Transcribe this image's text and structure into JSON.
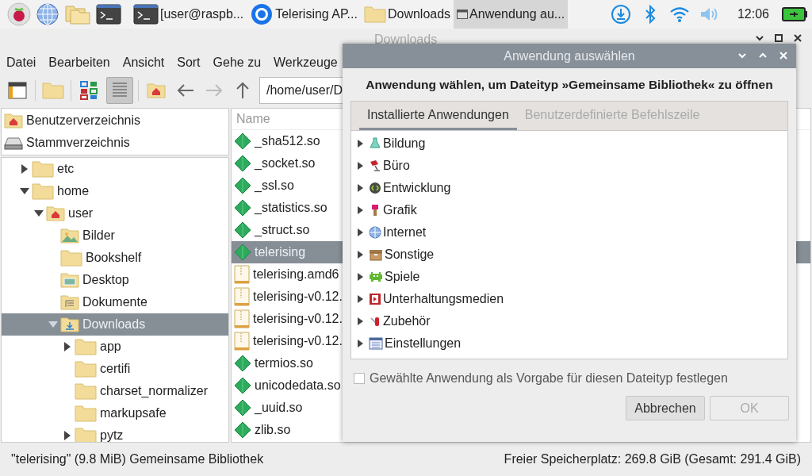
{
  "taskbar": {
    "launchers": [
      {
        "kind": "raspberry"
      },
      {
        "kind": "globe"
      },
      {
        "kind": "folders"
      },
      {
        "kind": "terminal"
      }
    ],
    "tasks": [
      {
        "kind": "terminal",
        "label": "[user@raspb...",
        "selected": false
      },
      {
        "kind": "browser",
        "label": "Telerising AP...",
        "selected": false
      },
      {
        "kind": "folder",
        "label": "Downloads",
        "selected": false
      },
      {
        "kind": "window",
        "label": "Anwendung au...",
        "selected": true
      }
    ],
    "clock": "12:06"
  },
  "file_manager": {
    "title": "Downloads",
    "menu": [
      "Datei",
      "Bearbeiten",
      "Ansicht",
      "Sort",
      "Gehe zu",
      "Werkzeuge"
    ],
    "path": "/home/user/D",
    "places": [
      {
        "kind": "home",
        "label": "Benutzerverzeichnis"
      },
      {
        "kind": "drive",
        "label": "Stammverzeichnis"
      }
    ],
    "tree": [
      {
        "label": "etc",
        "kind": "folder",
        "expanded": false,
        "selected": false
      },
      {
        "label": "home",
        "kind": "folder",
        "expanded": true,
        "selected": false,
        "children": [
          {
            "label": "user",
            "kind": "home",
            "expanded": true,
            "selected": false,
            "children": [
              {
                "label": "Bilder",
                "kind": "pictures",
                "selected": false
              },
              {
                "label": "Bookshelf",
                "kind": "folder",
                "selected": false
              },
              {
                "label": "Desktop",
                "kind": "desktop",
                "selected": false
              },
              {
                "label": "Dokumente",
                "kind": "documents",
                "selected": false
              },
              {
                "label": "Downloads",
                "kind": "downloads",
                "expanded": true,
                "selected": true,
                "children": [
                  {
                    "label": "app",
                    "kind": "folder",
                    "expanded": false,
                    "selected": false
                  },
                  {
                    "label": "certifi",
                    "kind": "folder",
                    "selected": false
                  },
                  {
                    "label": "charset_normalizer",
                    "kind": "folder",
                    "selected": false
                  },
                  {
                    "label": "markupsafe",
                    "kind": "folder",
                    "selected": false
                  },
                  {
                    "label": "pytz",
                    "kind": "folder",
                    "expanded": false,
                    "selected": false
                  }
                ]
              }
            ]
          }
        ]
      }
    ],
    "column": "Name",
    "files": [
      {
        "name": "_sha512.so",
        "kind": "library",
        "selected": false
      },
      {
        "name": "_socket.so",
        "kind": "library",
        "selected": false
      },
      {
        "name": "_ssl.so",
        "kind": "library",
        "selected": false
      },
      {
        "name": "_statistics.so",
        "kind": "library",
        "selected": false
      },
      {
        "name": "_struct.so",
        "kind": "library",
        "selected": false
      },
      {
        "name": "telerising",
        "kind": "library",
        "selected": true
      },
      {
        "name": "telerising.amd6",
        "kind": "archive",
        "selected": false
      },
      {
        "name": "telerising-v0.12.",
        "kind": "archive",
        "selected": false
      },
      {
        "name": "telerising-v0.12.",
        "kind": "archive",
        "selected": false
      },
      {
        "name": "telerising-v0.12.",
        "kind": "archive",
        "selected": false
      },
      {
        "name": "termios.so",
        "kind": "library",
        "selected": false
      },
      {
        "name": "unicodedata.so",
        "kind": "library",
        "selected": false
      },
      {
        "name": "_uuid.so",
        "kind": "library",
        "selected": false
      },
      {
        "name": "zlib.so",
        "kind": "library",
        "selected": false
      }
    ],
    "status_left": "\"telerising\" (9.8 MiB) Gemeinsame Bibliothek",
    "status_right": "Freier Speicherplatz: 269.8 GiB (Gesamt: 291.4 GiB)"
  },
  "dialog": {
    "title": "Anwendung auswählen",
    "heading": "Anwendung wählen, um Dateityp »Gemeinsame Bibliothek« zu öffnen",
    "tabs": [
      {
        "label": "Installierte Anwendungen",
        "selected": true
      },
      {
        "label": "Benutzerdefinierte Befehlszeile",
        "selected": false
      }
    ],
    "categories": [
      {
        "label": "Bildung",
        "kind": "flask",
        "expanded": false
      },
      {
        "label": "Büro",
        "kind": "lamp",
        "expanded": false
      },
      {
        "label": "Entwicklung",
        "kind": "code",
        "expanded": false
      },
      {
        "label": "Grafik",
        "kind": "brush",
        "expanded": false
      },
      {
        "label": "Internet",
        "kind": "smallglobe",
        "expanded": false
      },
      {
        "label": "Sonstige",
        "kind": "box",
        "expanded": false
      },
      {
        "label": "Spiele",
        "kind": "invader",
        "expanded": false
      },
      {
        "label": "Unterhaltungsmedien",
        "kind": "film",
        "expanded": false
      },
      {
        "label": "Zubehör",
        "kind": "knife",
        "expanded": false
      },
      {
        "label": "Einstellungen",
        "kind": "settings",
        "expanded": false
      }
    ],
    "default_checkbox": {
      "label": "Gewählte Anwendung als Vorgabe für diesen Dateityp festlegen",
      "checked": false
    },
    "buttons": [
      {
        "label": "Abbrechen",
        "disabled": false
      },
      {
        "label": "OK",
        "disabled": true
      }
    ]
  }
}
